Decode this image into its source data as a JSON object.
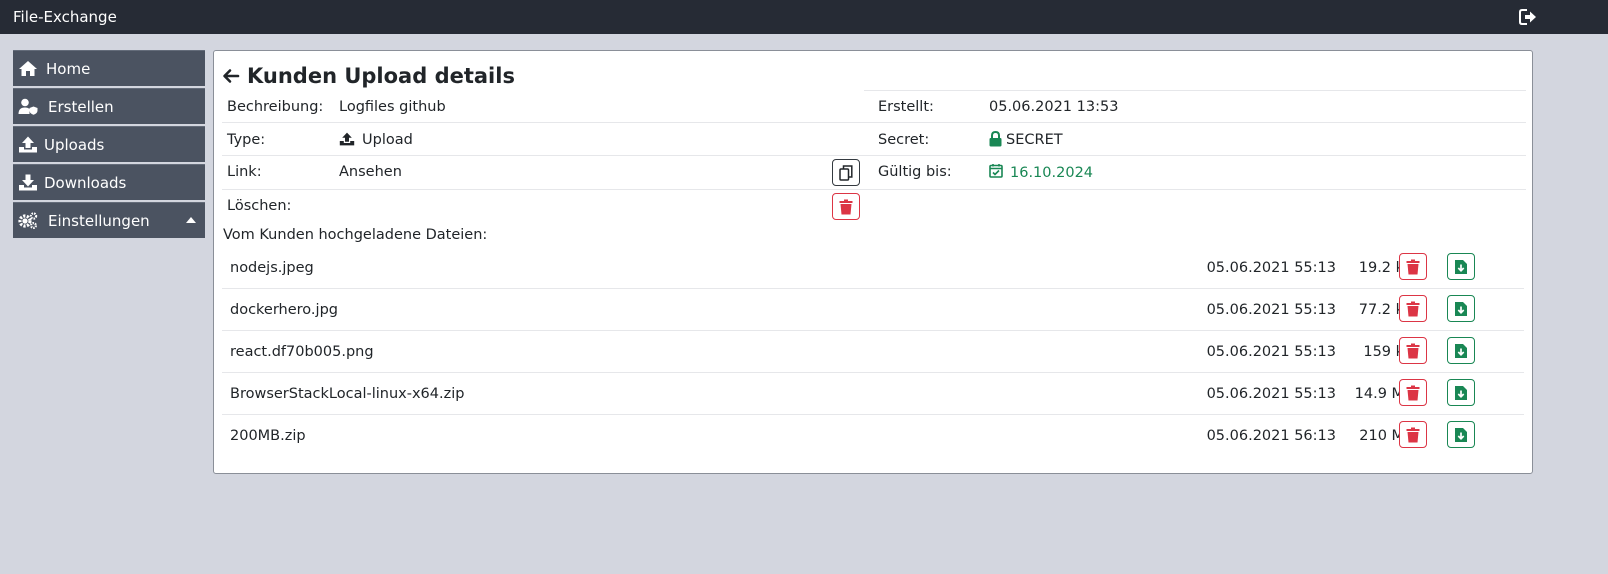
{
  "app": {
    "title": "File-Exchange",
    "logout_icon": "sign-out-icon"
  },
  "sidebar": {
    "items": [
      {
        "label": "Home",
        "icon": "home-icon"
      },
      {
        "label": "Erstellen",
        "icon": "user-shield-icon"
      },
      {
        "label": "Uploads",
        "icon": "upload-icon"
      },
      {
        "label": "Downloads",
        "icon": "download-icon"
      },
      {
        "label": "Einstellungen",
        "icon": "cogs-icon",
        "expanded": true
      }
    ]
  },
  "details": {
    "title": "Kunden Upload details",
    "description": {
      "label": "Bechreibung:",
      "value": "Logfiles github"
    },
    "type": {
      "label": "Type:",
      "value": "Upload"
    },
    "link": {
      "label": "Link:",
      "value": "Ansehen"
    },
    "delete": {
      "label": "Löschen:"
    },
    "created": {
      "label": "Erstellt:",
      "value": "05.06.2021 13:53"
    },
    "secret": {
      "label": "Secret:",
      "value": "SECRET"
    },
    "valid_until": {
      "label": "Gültig bis:",
      "value": "16.10.2024"
    }
  },
  "files": {
    "heading": "Vom Kunden hochgeladene Dateien:",
    "rows": [
      {
        "name": "nodejs.jpeg",
        "date": "05.06.2021 55:13",
        "size": "19.2 kB"
      },
      {
        "name": "dockerhero.jpg",
        "date": "05.06.2021 55:13",
        "size": "77.2 kB"
      },
      {
        "name": "react.df70b005.png",
        "date": "05.06.2021 55:13",
        "size": "159 kB"
      },
      {
        "name": "BrowserStackLocal-linux-x64.zip",
        "date": "05.06.2021 55:13",
        "size": "14.9 MB"
      },
      {
        "name": "200MB.zip",
        "date": "05.06.2021 56:13",
        "size": "210 MB"
      }
    ]
  },
  "colors": {
    "topbar": "#262b35",
    "sidebar": "#4b5361",
    "danger": "#dc3545",
    "success": "#198754",
    "background": "#d3d6df"
  }
}
